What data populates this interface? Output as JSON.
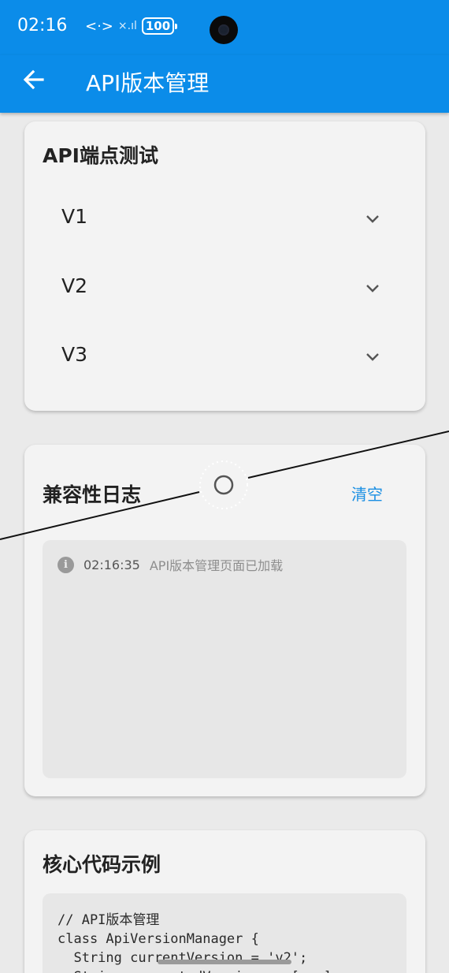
{
  "status_bar": {
    "time": "02:16",
    "data_icon": "<·>",
    "signal": "×.ıl",
    "battery": "100"
  },
  "app_bar": {
    "title": "API版本管理",
    "back_icon": "arrow-left-icon"
  },
  "api_card": {
    "title": "API端点测试",
    "versions": [
      {
        "label": "V1"
      },
      {
        "label": "V2"
      },
      {
        "label": "V3"
      }
    ]
  },
  "log_card": {
    "title": "兼容性日志",
    "clear_label": "清空",
    "entries": [
      {
        "time": "02:16:35",
        "message": "API版本管理页面已加载",
        "icon": "info-icon"
      }
    ]
  },
  "code_card": {
    "title": "核心代码示例",
    "code": "// API版本管理\nclass ApiVersionManager {\n  String currentVersion = 'v2';\n  String supportedVersions = [...];"
  },
  "colors": {
    "primary": "#0b8ce9",
    "card_bg": "#f3f3f3",
    "page_bg": "#eaeaea",
    "link": "#1a8fe3"
  }
}
